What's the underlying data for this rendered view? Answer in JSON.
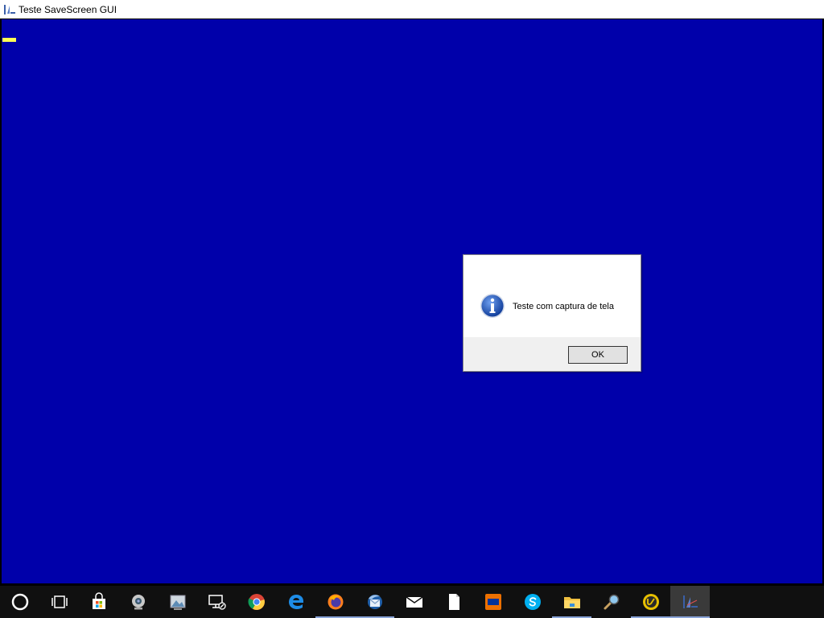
{
  "window": {
    "title": "Teste SaveScreen GUI",
    "icon": "java-app-icon",
    "background_color": "#0000aa"
  },
  "message_box": {
    "icon": "info-icon",
    "message": "Teste com captura de tela",
    "ok_label": "OK"
  },
  "taskbar": {
    "items": [
      {
        "name": "cortana-icon"
      },
      {
        "name": "task-view-icon"
      },
      {
        "name": "microsoft-store-icon"
      },
      {
        "name": "webcam-icon"
      },
      {
        "name": "photos-icon"
      },
      {
        "name": "remote-desktop-icon"
      },
      {
        "name": "chrome-icon"
      },
      {
        "name": "edge-icon"
      },
      {
        "name": "firefox-icon"
      },
      {
        "name": "thunderbird-icon"
      },
      {
        "name": "mail-icon"
      },
      {
        "name": "document-icon"
      },
      {
        "name": "itau-icon"
      },
      {
        "name": "skype-icon"
      },
      {
        "name": "file-explorer-icon"
      },
      {
        "name": "search-magnifier-icon"
      },
      {
        "name": "ultraedit-icon"
      },
      {
        "name": "java-app-icon"
      }
    ]
  }
}
